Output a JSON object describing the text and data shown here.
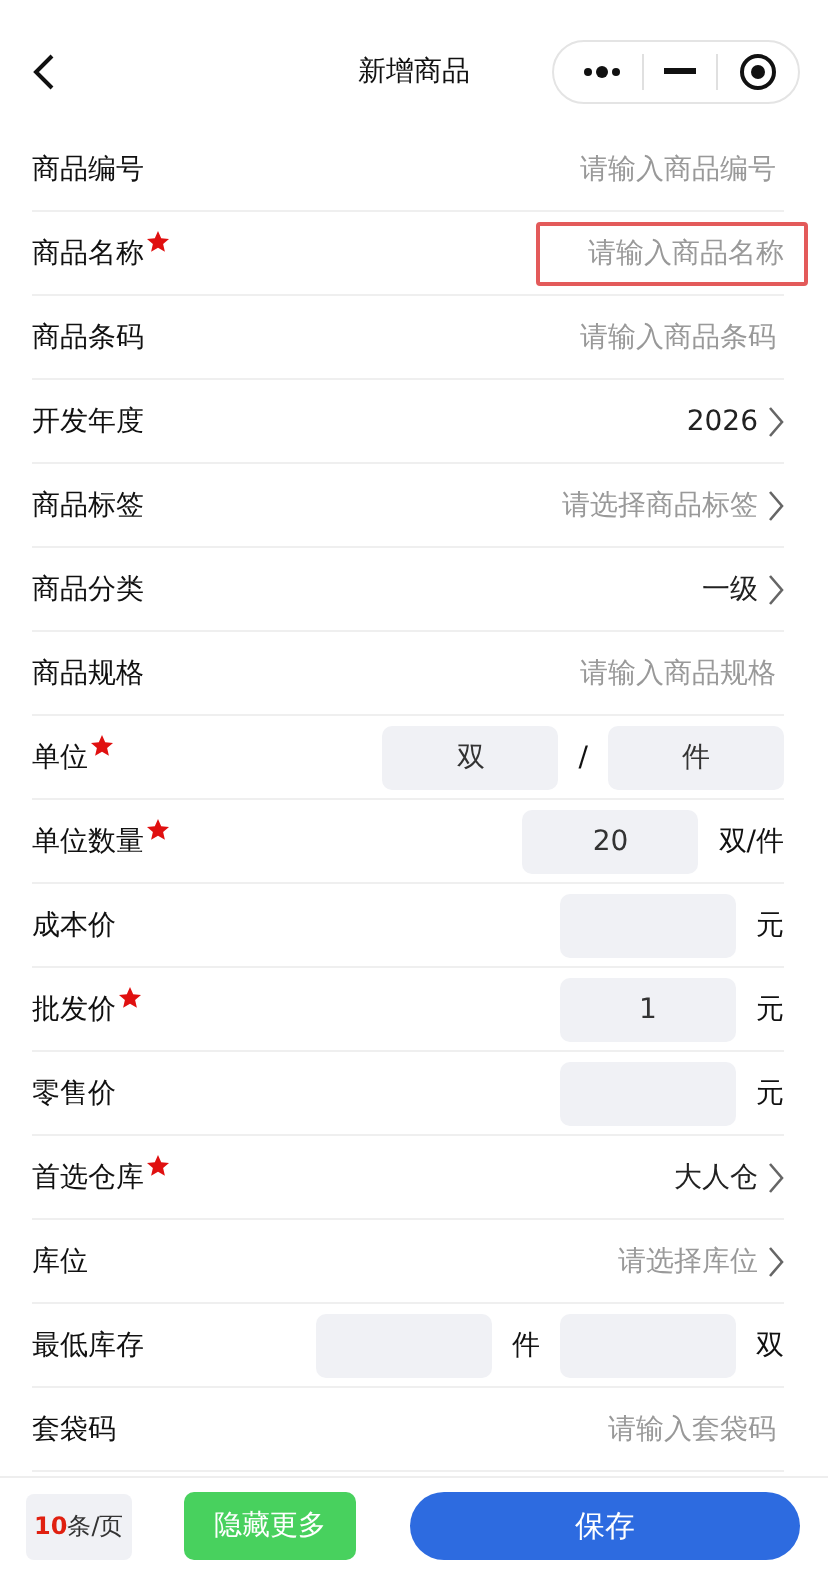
{
  "header": {
    "title": "新增商品"
  },
  "fields": [
    {
      "kind": "text",
      "label": "商品编号",
      "required": false,
      "highlighted": false,
      "placeholder": "请输入商品编号"
    },
    {
      "kind": "text",
      "label": "商品名称",
      "required": true,
      "highlighted": true,
      "placeholder": "请输入商品名称"
    },
    {
      "kind": "text",
      "label": "商品条码",
      "required": false,
      "highlighted": false,
      "placeholder": "请输入商品条码"
    },
    {
      "kind": "select",
      "label": "开发年度",
      "required": false,
      "value": "2026"
    },
    {
      "kind": "select",
      "label": "商品标签",
      "required": false,
      "placeholder": "请选择商品标签"
    },
    {
      "kind": "select",
      "label": "商品分类",
      "required": false,
      "value": "一级"
    },
    {
      "kind": "text",
      "label": "商品规格",
      "required": false,
      "highlighted": false,
      "placeholder": "请输入商品规格"
    },
    {
      "kind": "pair",
      "label": "单位",
      "required": true,
      "values": [
        "双",
        "件"
      ],
      "separator": "/"
    },
    {
      "kind": "box",
      "label": "单位数量",
      "required": true,
      "value": "20",
      "suffix": "双/件"
    },
    {
      "kind": "box",
      "label": "成本价",
      "required": false,
      "suffix": "元"
    },
    {
      "kind": "box",
      "label": "批发价",
      "required": true,
      "value": "1",
      "suffix": "元"
    },
    {
      "kind": "box",
      "label": "零售价",
      "required": false,
      "suffix": "元"
    },
    {
      "kind": "select",
      "label": "首选仓库",
      "required": true,
      "value": "大人仓"
    },
    {
      "kind": "select",
      "label": "库位",
      "required": false,
      "placeholder": "请选择库位"
    },
    {
      "kind": "dual",
      "label": "最低库存",
      "required": false,
      "suffixes": [
        "件",
        "双"
      ]
    },
    {
      "kind": "text",
      "label": "套袋码",
      "required": false,
      "highlighted": false,
      "placeholder": "请输入套袋码"
    }
  ],
  "footer": {
    "page_size": "**10**条/页",
    "toggle": "隐藏更多",
    "save": "保存"
  }
}
